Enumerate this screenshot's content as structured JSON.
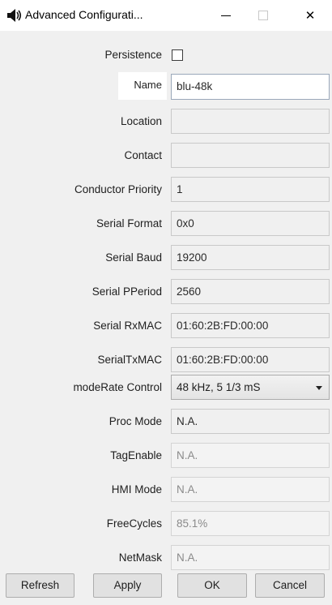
{
  "window": {
    "title": "Advanced Configurati...",
    "icons": [
      "speaker-icon",
      "minimize-icon",
      "maximize-icon",
      "close-icon"
    ],
    "close_glyph": "✕"
  },
  "form": {
    "persistence": {
      "label": "Persistence",
      "checked": false
    },
    "name": {
      "label": "Name",
      "value": "blu-48k"
    },
    "location": {
      "label": "Location",
      "value": ""
    },
    "contact": {
      "label": "Contact",
      "value": ""
    },
    "conductor_priority": {
      "label": "Conductor Priority",
      "value": "1"
    },
    "serial_format": {
      "label": "Serial Format",
      "value": "0x0"
    },
    "serial_baud": {
      "label": "Serial Baud",
      "value": "19200"
    },
    "serial_pperiod": {
      "label": "Serial PPeriod",
      "value": "2560"
    },
    "serial_rxmac": {
      "label": "Serial RxMAC",
      "value": "01:60:2B:FD:00:00"
    },
    "serial_txmac": {
      "label": "SerialTxMAC",
      "value": "01:60:2B:FD:00:00"
    },
    "moderate_control": {
      "label": "modeRate Control",
      "value": "48 kHz, 5 1/3 mS"
    },
    "proc_mode": {
      "label": "Proc Mode",
      "value": "N.A."
    },
    "tag_enable": {
      "label": "TagEnable",
      "value": "N.A."
    },
    "hmi_mode": {
      "label": "HMI Mode",
      "value": "N.A."
    },
    "free_cycles": {
      "label": "FreeCycles",
      "value": "85.1%"
    },
    "net_mask": {
      "label": "NetMask",
      "value": "N.A."
    }
  },
  "buttons": {
    "refresh": "Refresh",
    "apply": "Apply",
    "ok": "OK",
    "cancel": "Cancel"
  }
}
